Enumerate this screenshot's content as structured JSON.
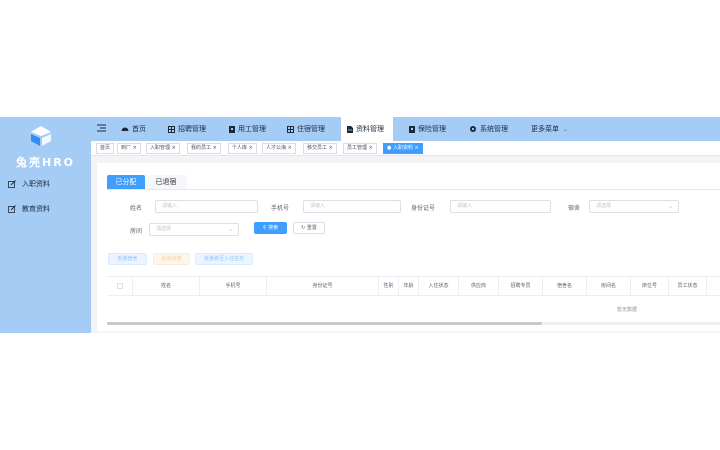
{
  "brand": {
    "name": "兔壳HRO"
  },
  "sidebar": {
    "items": [
      {
        "label": "入职资料",
        "icon": "edit-icon"
      },
      {
        "label": "教育资料",
        "icon": "edit-icon"
      }
    ]
  },
  "topnav": {
    "items": [
      {
        "label": "首页",
        "icon": "dashboard-icon"
      },
      {
        "label": "招聘管理",
        "icon": "grid-icon"
      },
      {
        "label": "用工管理",
        "icon": "badge-icon"
      },
      {
        "label": "住宿管理",
        "icon": "grid-icon"
      },
      {
        "label": "资料管理",
        "icon": "document-icon",
        "active": true
      },
      {
        "label": "保险管理",
        "icon": "badge-icon"
      },
      {
        "label": "系统管理",
        "icon": "gear-icon"
      },
      {
        "label": "更多菜单",
        "icon": "chevron-down-icon"
      }
    ]
  },
  "tags": [
    {
      "label": "首页"
    },
    {
      "label": "到厂 ×"
    },
    {
      "label": "入职管理 ×"
    },
    {
      "label": "我的员工 ×"
    },
    {
      "label": "个人库 ×"
    },
    {
      "label": "人才公海 ×"
    },
    {
      "label": "移交员工 ×"
    },
    {
      "label": "员工管理 ×"
    },
    {
      "label": "● 入职资料 ×",
      "active": true
    }
  ],
  "subtabs": [
    {
      "label": "已分配",
      "active": true
    },
    {
      "label": "已退宿"
    }
  ],
  "filters": {
    "name": {
      "label": "姓名",
      "placeholder": "请输入"
    },
    "phone": {
      "label": "手机号",
      "placeholder": "请输入"
    },
    "idcard": {
      "label": "身份证号",
      "placeholder": "请输入"
    },
    "dorm": {
      "label": "宿舍",
      "placeholder": "请选择"
    },
    "room": {
      "label": "房间",
      "placeholder": "请选择"
    }
  },
  "buttons": {
    "search": "搜索",
    "reset": "重置",
    "batch_dorm": "批量宿舍",
    "exit_dorm": "批量退宿",
    "batch_move": "批量移至入住任务"
  },
  "table": {
    "columns": [
      "姓名",
      "手机号",
      "身份证号",
      "性别",
      "年龄",
      "入住状态",
      "供应商",
      "招聘专员",
      "宿舍名",
      "房间名",
      "床位号",
      "员工状态"
    ],
    "empty_text": "暂无数据"
  },
  "colors": {
    "primary": "#409eff",
    "sidebar": "#a4ccf5"
  }
}
